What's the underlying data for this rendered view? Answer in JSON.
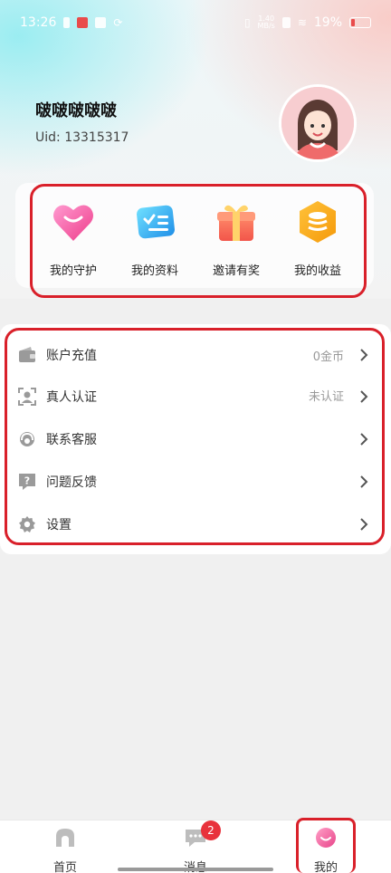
{
  "status_bar": {
    "time": "13:26",
    "network_speed": "1.40\nMB/s",
    "network_speed_value": "1.40",
    "network_speed_unit": "MB/s",
    "battery": "19%"
  },
  "profile": {
    "name": "啵啵啵啵啵",
    "uid": "Uid: 13315317"
  },
  "quick_actions": [
    {
      "label": "我的守护",
      "icon": "heart-icon"
    },
    {
      "label": "我的资料",
      "icon": "profile-card-icon"
    },
    {
      "label": "邀请有奖",
      "icon": "gift-icon"
    },
    {
      "label": "我的收益",
      "icon": "coins-icon"
    }
  ],
  "menu": [
    {
      "label": "账户充值",
      "value": "0金币",
      "icon": "wallet-icon"
    },
    {
      "label": "真人认证",
      "value": "未认证",
      "icon": "face-verify-icon"
    },
    {
      "label": "联系客服",
      "value": "",
      "icon": "headset-icon"
    },
    {
      "label": "问题反馈",
      "value": "",
      "icon": "question-icon"
    },
    {
      "label": "设置",
      "value": "",
      "icon": "gear-icon"
    }
  ],
  "tabbar": {
    "items": [
      {
        "label": "首页",
        "icon": "home-icon"
      },
      {
        "label": "消息",
        "icon": "message-icon"
      },
      {
        "label": "我的",
        "icon": "me-icon"
      }
    ],
    "message_badge": "2",
    "active": "我的"
  },
  "colors": {
    "highlight": "#d9202a",
    "badge": "#e8323c",
    "accent_pink": "#f0609a"
  }
}
